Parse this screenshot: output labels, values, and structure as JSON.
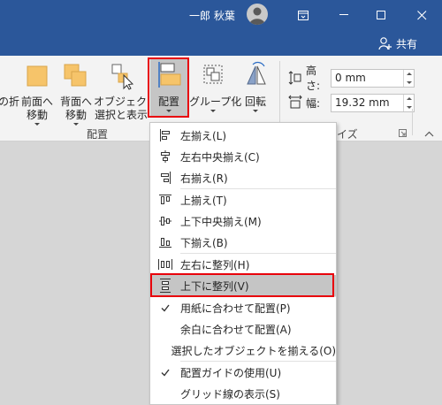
{
  "titlebar": {
    "user_name": "一郎 秋葉",
    "share_label": "共有"
  },
  "ribbon": {
    "buttons": {
      "wrap_partial": "の折",
      "bring_forward": [
        "前面へ",
        "移動"
      ],
      "send_backward": [
        "背面へ",
        "移動"
      ],
      "selection_pane": [
        "オブジェクトの",
        "選択と表示"
      ],
      "align": "配置",
      "group": "グループ化",
      "rotate": "回転"
    },
    "group_labels": {
      "arrange": "配置",
      "size_partial": "イズ"
    },
    "size": {
      "height_label": "高さ:",
      "height_value": "0 mm",
      "width_label": "幅:",
      "width_value": "19.32 mm"
    }
  },
  "menu": {
    "items": [
      {
        "label": "左揃え(L)",
        "icon": "align-left-icon"
      },
      {
        "label": "左右中央揃え(C)",
        "icon": "align-center-icon"
      },
      {
        "label": "右揃え(R)",
        "icon": "align-right-icon"
      },
      {
        "label": "上揃え(T)",
        "icon": "align-top-icon"
      },
      {
        "label": "上下中央揃え(M)",
        "icon": "align-middle-icon"
      },
      {
        "label": "下揃え(B)",
        "icon": "align-bottom-icon"
      },
      {
        "label": "左右に整列(H)",
        "icon": "distribute-horizontal-icon"
      },
      {
        "label": "上下に整列(V)",
        "icon": "distribute-vertical-icon"
      },
      {
        "label": "用紙に合わせて配置(P)",
        "icon": "check-icon"
      },
      {
        "label": "余白に合わせて配置(A)",
        "icon": ""
      },
      {
        "label": "選択したオブジェクトを揃える(O)",
        "icon": ""
      },
      {
        "label": "配置ガイドの使用(U)",
        "icon": "check-icon"
      },
      {
        "label": "グリッド線の表示(S)",
        "icon": ""
      }
    ]
  },
  "colors": {
    "title_bar": "#2b579a",
    "highlight_border": "#e8000b",
    "menu_hover": "#c5c5c5"
  }
}
